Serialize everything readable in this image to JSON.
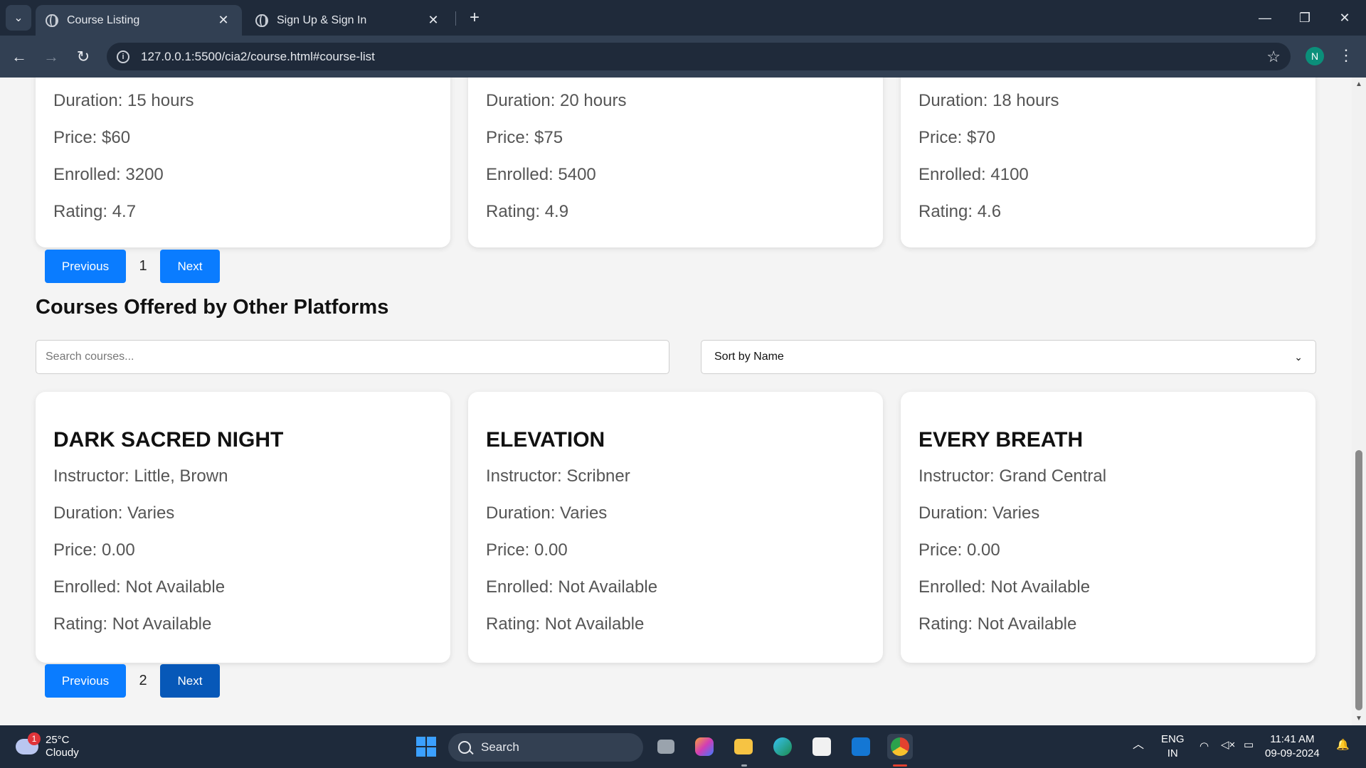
{
  "browser": {
    "tabs": [
      {
        "title": "Course Listing",
        "active": true
      },
      {
        "title": "Sign Up & Sign In",
        "active": false
      }
    ],
    "url": "127.0.0.1:5500/cia2/course.html#course-list",
    "profile_initial": "N",
    "controls": {
      "minimize": "—",
      "restore": "❐",
      "close": "✕",
      "new_tab": "+",
      "tab_close": "✕",
      "star": "☆",
      "menu": "⋮"
    }
  },
  "top_cards": [
    {
      "duration": "Duration: 15 hours",
      "price": "Price: $60",
      "enrolled": "Enrolled: 3200",
      "rating": "Rating: 4.7"
    },
    {
      "duration": "Duration: 20 hours",
      "price": "Price: $75",
      "enrolled": "Enrolled: 5400",
      "rating": "Rating: 4.9"
    },
    {
      "duration": "Duration: 18 hours",
      "price": "Price: $70",
      "enrolled": "Enrolled: 4100",
      "rating": "Rating: 4.6"
    }
  ],
  "pager_top": {
    "prev": "Previous",
    "page": "1",
    "next": "Next"
  },
  "section": {
    "title": "Courses Offered by Other Platforms",
    "search_placeholder": "Search courses...",
    "sort_label": "Sort by Name"
  },
  "other_cards": [
    {
      "title": "DARK SACRED NIGHT",
      "instructor": "Instructor: Little, Brown",
      "duration": "Duration: Varies",
      "price": "Price: 0.00",
      "enrolled": "Enrolled: Not Available",
      "rating": "Rating: Not Available"
    },
    {
      "title": "ELEVATION",
      "instructor": "Instructor: Scribner",
      "duration": "Duration: Varies",
      "price": "Price: 0.00",
      "enrolled": "Enrolled: Not Available",
      "rating": "Rating: Not Available"
    },
    {
      "title": "EVERY BREATH",
      "instructor": "Instructor: Grand Central",
      "duration": "Duration: Varies",
      "price": "Price: 0.00",
      "enrolled": "Enrolled: Not Available",
      "rating": "Rating: Not Available"
    }
  ],
  "pager_bottom": {
    "prev": "Previous",
    "page": "2",
    "next": "Next"
  },
  "taskbar": {
    "weather_badge": "1",
    "temperature": "25°C",
    "condition": "Cloudy",
    "search_label": "Search",
    "lang_line1": "ENG",
    "lang_line2": "IN",
    "time": "11:41 AM",
    "date": "09-09-2024"
  },
  "colors": {
    "accent": "#0a7cff",
    "accent_active": "#0758b8",
    "chrome_dark": "#1f2a3a",
    "chrome_mid": "#324053"
  }
}
